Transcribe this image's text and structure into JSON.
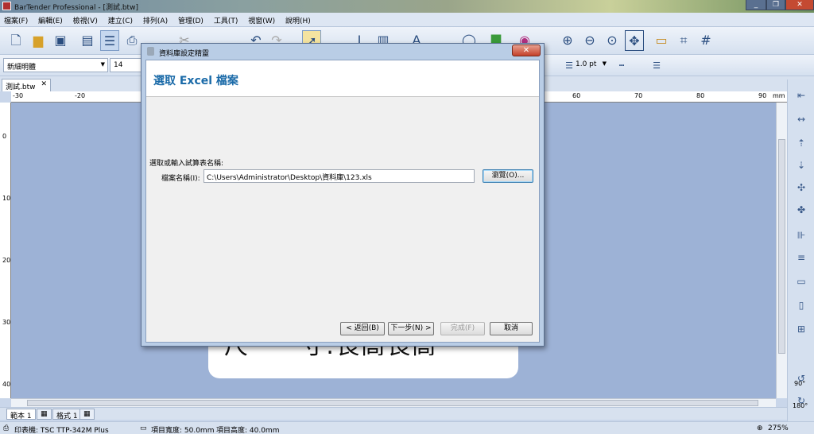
{
  "app": {
    "title": "BarTender Professional - [測試.btw]",
    "window_controls": [
      "_",
      "❐",
      "✕"
    ]
  },
  "menu": [
    "檔案(F)",
    "編輯(E)",
    "檢視(V)",
    "建立(C)",
    "排列(A)",
    "管理(D)",
    "工具(T)",
    "視窗(W)",
    "說明(H)"
  ],
  "format_toolbar": {
    "font_name": "新細明體",
    "font_size": "14",
    "line_width": "1.0 pt"
  },
  "document_tab": {
    "label": "測試.btw",
    "close": "✕"
  },
  "ruler": {
    "unit": "mm",
    "h_ticks": [
      "-30",
      "-20",
      "60",
      "70",
      "80",
      "90"
    ],
    "v_ticks": [
      "0",
      "10",
      "20",
      "30",
      "40"
    ]
  },
  "label_preview_text": "尺　　寸:長高長高",
  "sheet_tabs": [
    "範本 1",
    "格式 1"
  ],
  "status": {
    "printer": "印表機: TSC TTP-342M Plus",
    "item_width": "項目寬度: 50.0mm",
    "item_height": "項目高度: 40.0mm",
    "zoom": "275%"
  },
  "right_toolbar": {
    "rotate_90": "90°",
    "rotate_180": "180°"
  },
  "dialog": {
    "title": "資料庫設定精靈",
    "heading": "選取 Excel 檔案",
    "prompt": "選取或輸入試算表名稱:",
    "file_label": "檔案名稱(I):",
    "file_value": "C:\\Users\\Administrator\\Desktop\\資料庫\\123.xls",
    "browse_button": "瀏覽(O)...",
    "back_button": "< 返回(B)",
    "next_button": "下一步(N) >",
    "finish_button": "完成(F)",
    "cancel_button": "取消"
  }
}
